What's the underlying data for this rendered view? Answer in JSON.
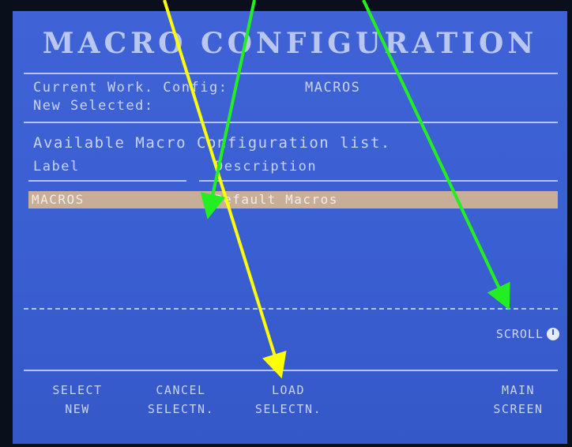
{
  "screen": {
    "title": "MACRO CONFIGURATION",
    "current_label": "Current Work. Config:",
    "current_value": "MACROS",
    "new_selected_label": "New Selected:",
    "available_heading": "Available Macro Configuration list.",
    "columns": {
      "label": "Label",
      "description": "Description"
    },
    "rows": [
      {
        "label": "MACROS",
        "description": "Default Macros",
        "selected": true
      }
    ],
    "scroll_label": "SCROLL"
  },
  "softkeys": [
    {
      "line1": "SELECT",
      "line2": "NEW"
    },
    {
      "line1": "CANCEL",
      "line2": "SELECTN."
    },
    {
      "line1": "LOAD",
      "line2": "SELECTN."
    },
    {
      "line1": "MAIN",
      "line2": "SCREEN"
    }
  ],
  "colors": {
    "screen_blue": "#3a5fd2",
    "highlight_row": "#c8ae96",
    "arrow_yellow": "#ffff00",
    "arrow_green": "#22ee22"
  }
}
